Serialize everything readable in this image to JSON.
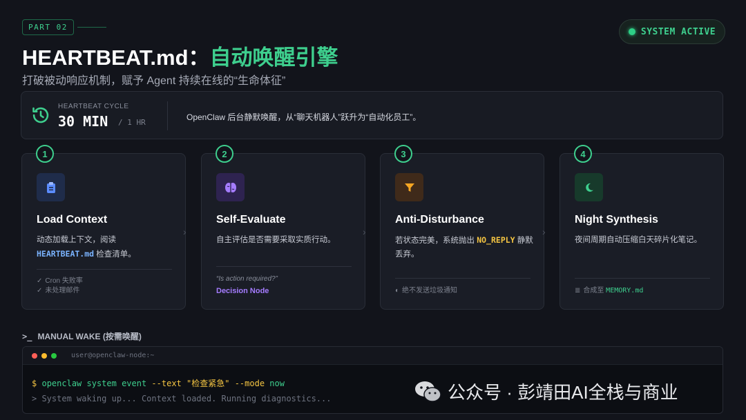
{
  "header": {
    "part_tag": "PART 02",
    "title_main": "HEARTBEAT.md：",
    "title_accent": "自动唤醒引擎",
    "subtitle": "打破被动响应机制，赋予 Agent 持续在线的“生命体征”",
    "status": "SYSTEM ACTIVE"
  },
  "cycle": {
    "icon": "clock-history-icon",
    "label": "HEARTBEAT CYCLE",
    "value": "30 MIN",
    "alt": "/ 1 HR",
    "description": "OpenClaw 后台静默唤醒，从“聊天机器人”跃升为“自动化员工”。"
  },
  "steps": [
    {
      "number": "1",
      "icon": "clipboard-icon",
      "title": "Load Context",
      "text_a": "动态加载上下文，阅读",
      "text_code": "HEARTBEAT.md",
      "text_b": " 检查清单。",
      "checks": [
        "Cron 失败率",
        "未处理邮件"
      ]
    },
    {
      "number": "2",
      "icon": "brain-icon",
      "title": "Self-Evaluate",
      "text": "自主评估是否需要采取实质行动。",
      "question": "“Is action required?”",
      "node": "Decision Node"
    },
    {
      "number": "3",
      "icon": "filter-icon",
      "title": "Anti-Disturbance",
      "text_a": "若状态完美，系统抛出 ",
      "text_code": "NO_REPLY",
      "text_b": " 静默丢弃。",
      "foot": "绝不发送垃圾通知"
    },
    {
      "number": "4",
      "icon": "moon-icon",
      "title": "Night Synthesis",
      "text": "夜间周期自动压缩白天碎片化笔记。",
      "foot_a": "合成至 ",
      "foot_code": "MEMORY.md"
    }
  ],
  "manual_wake": {
    "title": "MANUAL WAKE (按需唤醒)",
    "host": "user@openclaw-node:~",
    "prompt": "$",
    "cmd": "openclaw system event",
    "flag1": "--text",
    "arg1": "\"检查紧急\"",
    "flag2": "--mode",
    "arg2": "now",
    "output": "> System waking up... Context loaded. Running diagnostics..."
  },
  "watermark": "公众号 · 彭靖田AI全栈与商业",
  "colors": {
    "accent": "#3ecf8e",
    "background": "#12141b",
    "card": "#1a1d26",
    "highlight_blue": "#7ab3ff",
    "highlight_yellow": "#f5c542"
  }
}
